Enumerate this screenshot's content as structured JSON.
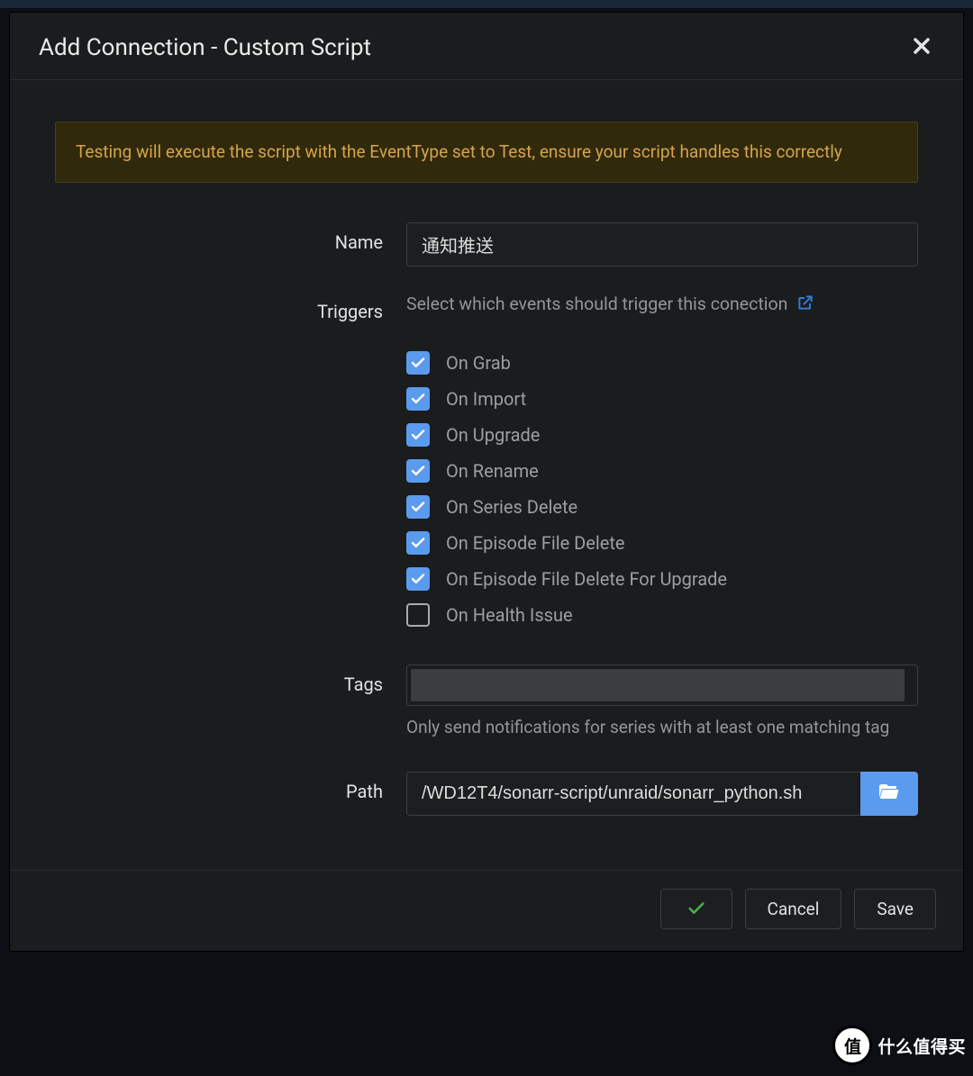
{
  "modal": {
    "title": "Add Connection - Custom Script",
    "alert": "Testing will execute the script with the EventType set to Test, ensure your script handles this correctly",
    "labels": {
      "name": "Name",
      "triggers": "Triggers",
      "tags": "Tags",
      "path": "Path"
    },
    "name_value": "通知推送",
    "triggers_hint": "Select which events should trigger this conection",
    "triggers": [
      {
        "label": "On Grab",
        "checked": true
      },
      {
        "label": "On Import",
        "checked": true
      },
      {
        "label": "On Upgrade",
        "checked": true
      },
      {
        "label": "On Rename",
        "checked": true
      },
      {
        "label": "On Series Delete",
        "checked": true
      },
      {
        "label": "On Episode File Delete",
        "checked": true
      },
      {
        "label": "On Episode File Delete For Upgrade",
        "checked": true
      },
      {
        "label": "On Health Issue",
        "checked": false
      }
    ],
    "tags_help": "Only send notifications for series with at least one matching tag",
    "path_value": "/WD12T4/sonarr-script/unraid/sonarr_python.sh",
    "footer": {
      "cancel": "Cancel",
      "save": "Save"
    }
  },
  "watermark": {
    "badge": "值",
    "text": "什么值得买"
  }
}
